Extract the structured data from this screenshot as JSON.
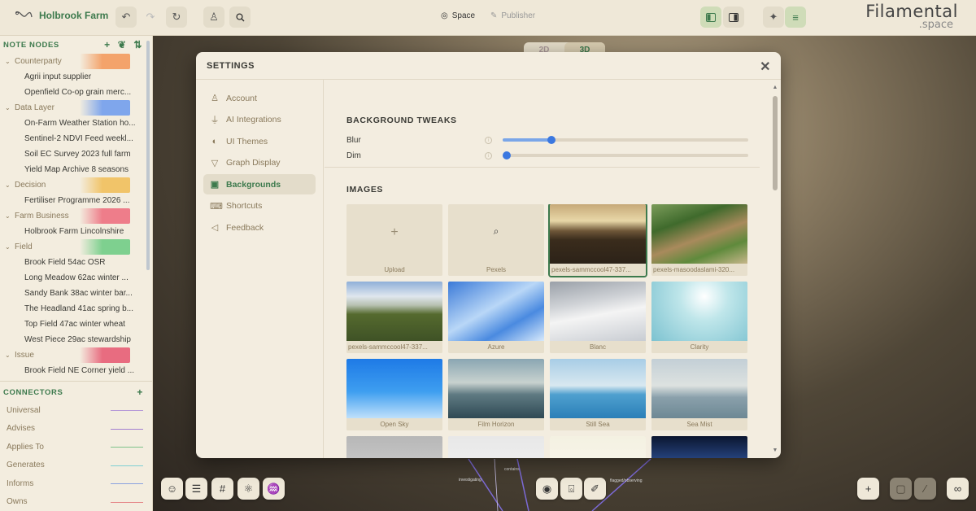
{
  "app": {
    "workspace_title": "Holbrook Farm",
    "logo_line1": "Filamental",
    "logo_line2": ".space"
  },
  "topbar": {
    "modes": [
      {
        "label": "Space",
        "icon": "target-icon",
        "active": true
      },
      {
        "label": "Publisher",
        "icon": "pen-icon",
        "active": false
      }
    ]
  },
  "sidebar": {
    "nodes_heading": "NOTE NODES",
    "groups": [
      {
        "name": "Counterparty",
        "color": "#f3a36b",
        "items": [
          "Agrii input supplier",
          "Openfield Co-op grain merc..."
        ]
      },
      {
        "name": "Data Layer",
        "color": "#7fa6ec",
        "items": [
          "On-Farm Weather Station ho...",
          "Sentinel-2 NDVI Feed weekl...",
          "Soil EC Survey 2023 full farm",
          "Yield Map Archive 8 seasons"
        ]
      },
      {
        "name": "Decision",
        "color": "#f1c469",
        "items": [
          "Fertiliser Programme 2026 ..."
        ]
      },
      {
        "name": "Farm Business",
        "color": "#ee7d8a",
        "items": [
          "Holbrook Farm Lincolnshire"
        ]
      },
      {
        "name": "Field",
        "color": "#7ed08f",
        "items": [
          "Brook Field 54ac OSR",
          "Long Meadow 62ac winter ...",
          "Sandy Bank 38ac winter bar...",
          "The Headland 41ac spring b...",
          "Top Field 47ac winter wheat",
          "West Piece 29ac stewardship"
        ]
      },
      {
        "name": "Issue",
        "color": "#e86c80",
        "items": [
          "Brook Field NE Corner yield ..."
        ]
      }
    ],
    "connectors_heading": "CONNECTORS",
    "connectors": [
      {
        "name": "Universal",
        "color": "#b69ad8"
      },
      {
        "name": "Advises",
        "color": "#a27fd0"
      },
      {
        "name": "Applies To",
        "color": "#7fc38a"
      },
      {
        "name": "Generates",
        "color": "#7fcfd3"
      },
      {
        "name": "Informs",
        "color": "#8aa2df"
      },
      {
        "name": "Owns",
        "color": "#e58a8a"
      }
    ]
  },
  "view_toggle": {
    "options": [
      "2D",
      "3D"
    ],
    "selected": "3D"
  },
  "settings": {
    "title": "SETTINGS",
    "menu": [
      {
        "label": "Account",
        "icon": "user-icon"
      },
      {
        "label": "AI Integrations",
        "icon": "plug-icon"
      },
      {
        "label": "UI Themes",
        "icon": "palette-icon"
      },
      {
        "label": "Graph Display",
        "icon": "funnel-icon"
      },
      {
        "label": "Backgrounds",
        "icon": "image-icon",
        "active": true
      },
      {
        "label": "Shortcuts",
        "icon": "keyboard-icon"
      },
      {
        "label": "Feedback",
        "icon": "megaphone-icon"
      }
    ],
    "background_tweaks": {
      "title": "BACKGROUND TWEAKS",
      "sliders": [
        {
          "label": "Blur",
          "value": 0.2
        },
        {
          "label": "Dim",
          "value": 0.0
        }
      ]
    },
    "images": {
      "title": "IMAGES",
      "tiles": [
        {
          "caption": "Upload",
          "kind": "upload"
        },
        {
          "caption": "Pexels",
          "kind": "search"
        },
        {
          "caption": "pexels-sammccool47-337...",
          "kind": "photo",
          "selected": true
        },
        {
          "caption": "pexels-masoodaslami-320...",
          "kind": "photo"
        },
        {
          "caption": "pexels-sammccool47-337...",
          "kind": "photo"
        },
        {
          "caption": "Azure",
          "kind": "photo"
        },
        {
          "caption": "Blanc",
          "kind": "photo"
        },
        {
          "caption": "Clarity",
          "kind": "photo"
        },
        {
          "caption": "Open Sky",
          "kind": "photo"
        },
        {
          "caption": "Film Horizon",
          "kind": "photo"
        },
        {
          "caption": "Still Sea",
          "kind": "photo"
        },
        {
          "caption": "Sea Mist",
          "kind": "photo"
        },
        {
          "caption": "",
          "kind": "photo"
        },
        {
          "caption": "",
          "kind": "photo"
        },
        {
          "caption": "",
          "kind": "photo"
        },
        {
          "caption": "",
          "kind": "photo"
        }
      ]
    }
  },
  "canvas": {
    "edge_labels": [
      "investigating",
      "contains",
      "flagged/observing"
    ]
  }
}
